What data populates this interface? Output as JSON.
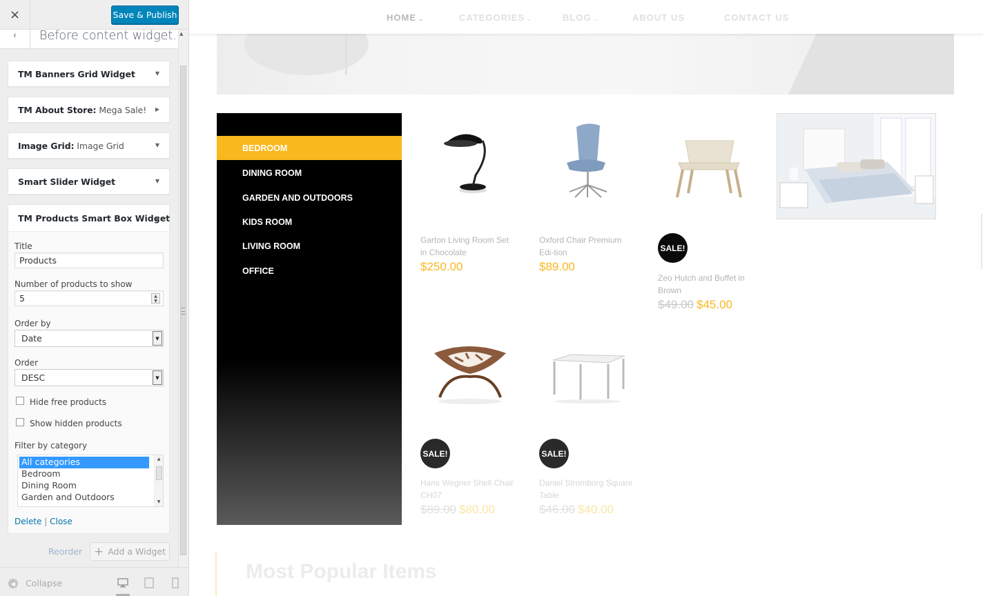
{
  "sidebar": {
    "close_icon": "×",
    "save_label": "Save & Publish",
    "section_title": "Before content widget...",
    "widgets": [
      {
        "title": "TM Banners Grid Widget",
        "sub": "",
        "arrow": "▼"
      },
      {
        "title": "TM About Store:",
        "sub": " Mega Sale!",
        "arrow": "▶"
      },
      {
        "title": "Image Grid:",
        "sub": " Image Grid",
        "arrow": "▼"
      },
      {
        "title": "Smart Slider Widget",
        "sub": "",
        "arrow": "▼"
      }
    ],
    "open_widget": {
      "title": "TM Products Smart Box Widget",
      "arrow": "▲",
      "title_label": "Title",
      "title_value": "Products",
      "count_label": "Number of products to show",
      "count_value": "5",
      "order_by_label": "Order by",
      "order_by_value": "Date",
      "order_label": "Order",
      "order_value": "DESC",
      "hide_free_label": "Hide free products",
      "show_hidden_label": "Show hidden products",
      "filter_label": "Filter by category",
      "filter_options": [
        "All categories",
        "Bedroom",
        "Dining Room",
        "Garden and Outdoors"
      ],
      "delete_label": "Delete",
      "separator": " | ",
      "close_label": "Close"
    },
    "reorder_label": "Reorder",
    "add_widget_label": "Add a Widget",
    "collapse_label": "Collapse"
  },
  "preview": {
    "nav": [
      {
        "label": "HOME",
        "chev": "⌄"
      },
      {
        "label": "CATEGORIES",
        "chev": "⌄"
      },
      {
        "label": "BLOG",
        "chev": "⌄"
      },
      {
        "label": "ABOUT US",
        "chev": ""
      },
      {
        "label": "CONTACT US",
        "chev": ""
      }
    ],
    "categories": [
      "BEDROOM",
      "DINING ROOM",
      "GARDEN AND OUTDOORS",
      "KIDS ROOM",
      "LIVING ROOM",
      "OFFICE"
    ],
    "sale_badge": "SALE!",
    "products": [
      {
        "name": "Garton Living Room Set in Chocolate",
        "old_price": "",
        "price": "$250.00",
        "sale": false
      },
      {
        "name": "Oxford Chair Premium Edi-tion",
        "old_price": "",
        "price": "$89.00",
        "sale": false
      },
      {
        "name": "Zeo Hutch and Buffet in Brown",
        "old_price": "$49.00",
        "price": "$45.00",
        "sale": true
      },
      {
        "name": "Hans Wegner Shell Chair CH07",
        "old_price": "$89.00",
        "price": "$80.00",
        "sale": true
      },
      {
        "name": "Daniel Stromborg Square Table",
        "old_price": "$46.00",
        "price": "$40.00",
        "sale": true
      }
    ],
    "section_heading": "Most Popular Items"
  },
  "colors": {
    "accent": "#f8b81e",
    "publish_blue": "#0085ba",
    "menu_bg": "#000000"
  }
}
